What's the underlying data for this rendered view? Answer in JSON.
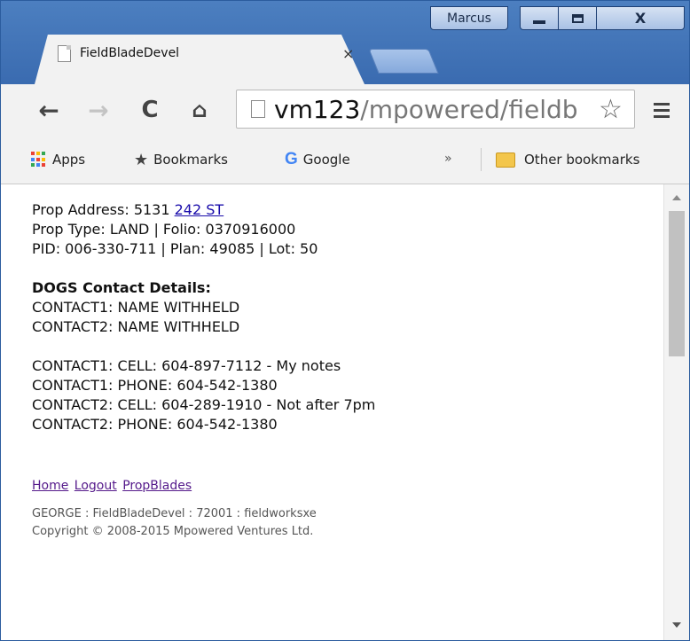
{
  "window": {
    "user": "Marcus",
    "close_glyph": "X"
  },
  "tab": {
    "title": "FieldBladeDevel",
    "close_glyph": "×"
  },
  "toolbar": {
    "url_host": "vm123",
    "url_path": "/mpowered/fieldb"
  },
  "bookmarks": {
    "apps_label": "Apps",
    "bookmarks_label": "Bookmarks",
    "google_label": "Google",
    "overflow": "»",
    "other_label": "Other bookmarks"
  },
  "page": {
    "address_prefix": "Prop Address: 5131 ",
    "address_link": "242 ST",
    "prop_type": "Prop Type: LAND | Folio: 0370916000",
    "pid": "PID: 006-330-711 | Plan: 49085 | Lot: 50",
    "contact_heading": "DOGS Contact Details:",
    "contact1_name": "CONTACT1: NAME WITHHELD",
    "contact2_name": "CONTACT2: NAME WITHHELD",
    "contact1_cell": "CONTACT1: CELL: 604-897-7112 - My notes",
    "contact1_phone": "CONTACT1: PHONE: 604-542-1380",
    "contact2_cell": "CONTACT2: CELL: 604-289-1910 - Not after 7pm",
    "contact2_phone": "CONTACT2: PHONE: 604-542-1380",
    "links": [
      "Home",
      "Logout",
      "PropBlades"
    ],
    "footer_line1": "GEORGE : FieldBladeDevel : 72001 : fieldworksxe",
    "footer_line2": "Copyright © 2008-2015 Mpowered Ventures Ltd."
  },
  "colors": {
    "title_bar": "#3a6bb0",
    "link": "#1a0dab",
    "visited_link": "#551a8b"
  }
}
